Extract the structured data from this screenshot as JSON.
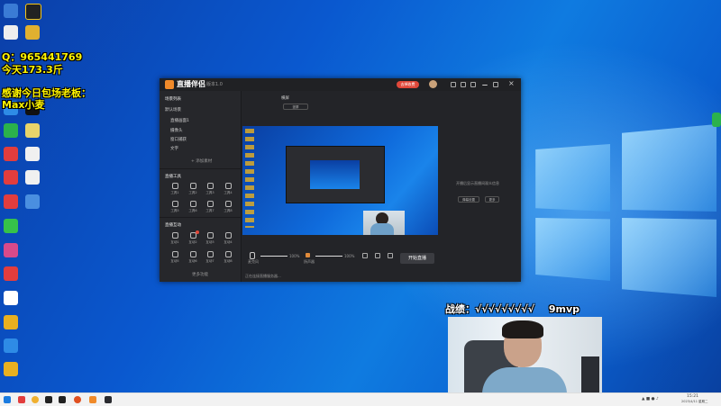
{
  "overlay": {
    "qq": "Q：965441769",
    "today": "今天173.3斤",
    "thanks": "感谢今日包场老板：",
    "boss": "Max小麦",
    "record_label": "战绩：√√√√√√√√√",
    "record_value": "9mvp"
  },
  "app": {
    "title": "直播伴侣",
    "version": "版本1.0",
    "badge": "去掉收费",
    "scene_header": "场景列表",
    "scene_tab": "默认场景",
    "scenes": [
      "直播画面1",
      "摄像头",
      "窗口捕获",
      "文字"
    ],
    "add_source": "+ 添加素材",
    "tools_header": "直播工具",
    "tools": [
      "工具1",
      "工具2",
      "工具3",
      "工具4",
      "工具5",
      "工具6",
      "工具7",
      "工具8"
    ],
    "more_header": "直播互动",
    "more": [
      "互动1",
      "互动2",
      "互动3",
      "互动4",
      "互动5",
      "互动6",
      "互动7",
      "互动8"
    ],
    "more_footer": "更多功能",
    "preview_tab": "横屏",
    "preview_mode": "竖屏",
    "right_hint": "开播后显示直播间观众信息",
    "right_btn1": "弹幕设置",
    "right_btn2": "更多",
    "mic_label": "麦克风",
    "speaker_label": "扬声器",
    "mic_vol": "100%",
    "speaker_vol": "100%",
    "start_live": "开始直播",
    "status": "正在连接直播服务器..."
  },
  "taskbar": {
    "time": "15:21",
    "date": "2023/4/11 星期二"
  },
  "colors": {
    "overlay_yellow": "#fff500",
    "window_bg": "#2a2b30",
    "live_red": "#e0483a"
  }
}
